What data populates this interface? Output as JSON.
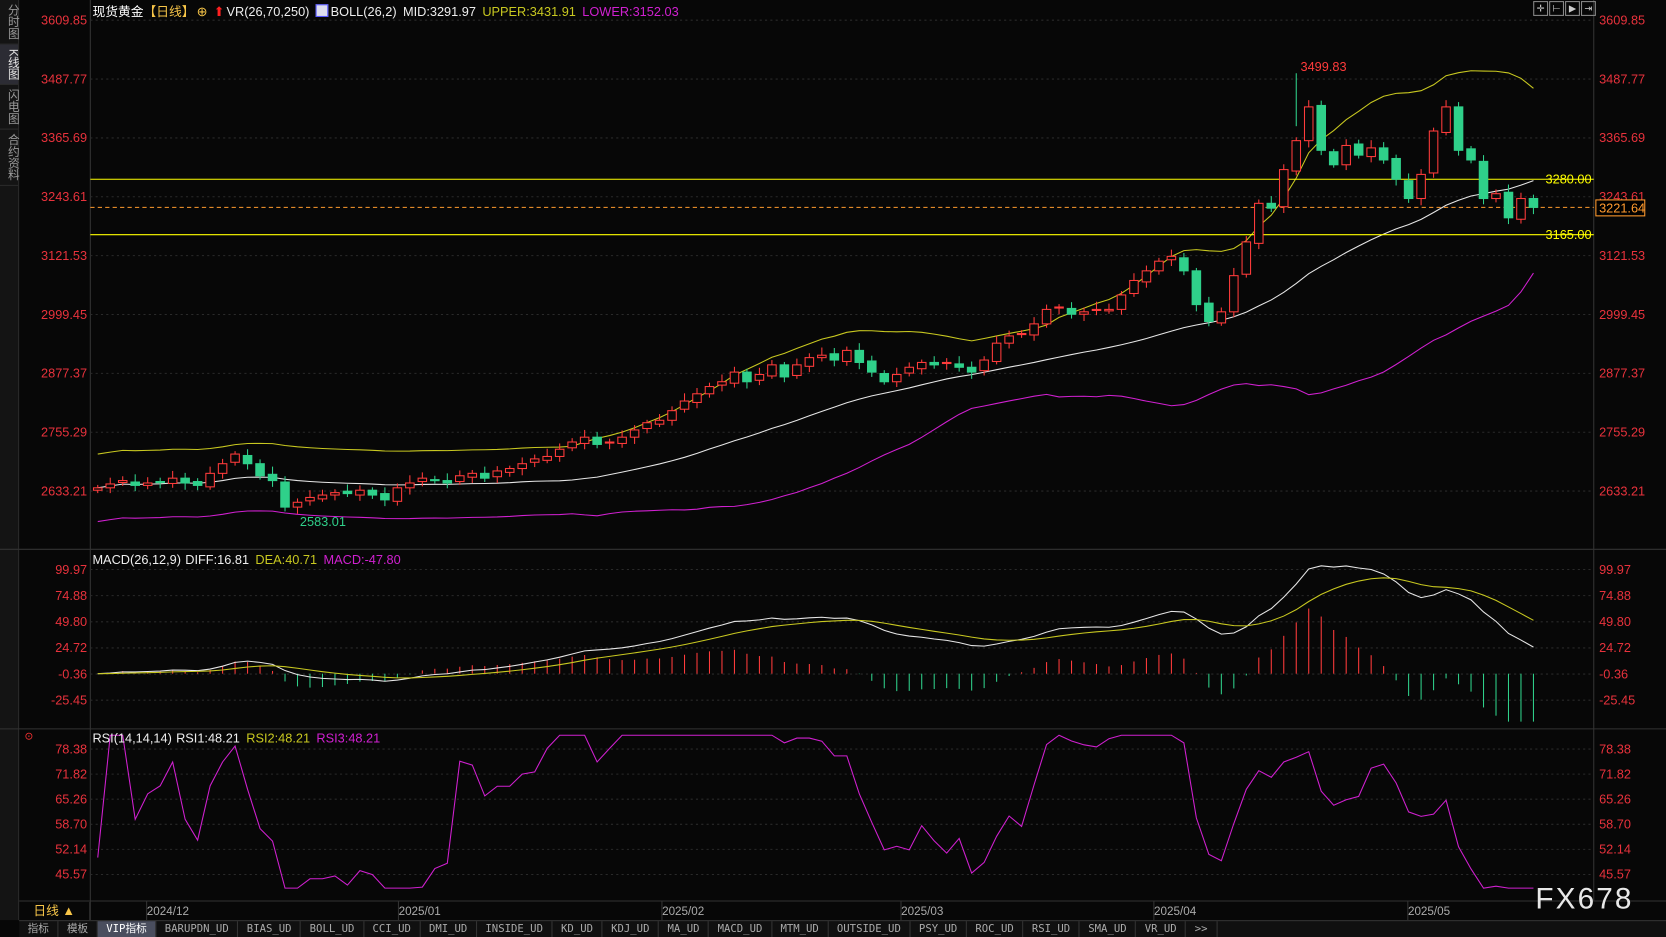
{
  "sidebar": {
    "tabs": [
      "分时图",
      "K线图",
      "闪电图",
      "合约资料"
    ],
    "active": 1
  },
  "header": {
    "instrument": "现货黄金",
    "period_tag": "【日线】",
    "vr": "VR(26,70,250)",
    "boll": "BOLL(26,2)",
    "mid": "MID:3291.97",
    "upper": "UPPER:3431.91",
    "lower": "LOWER:3152.03"
  },
  "macd_header": {
    "name": "MACD(26,12,9)",
    "diff": "DIFF:16.81",
    "dea": "DEA:40.71",
    "macd": "MACD:-47.80"
  },
  "rsi_header": {
    "name": "RSI(14,14,14)",
    "rsi1": "RSI1:48.21",
    "rsi2": "RSI2:48.21",
    "rsi3": "RSI3:48.21"
  },
  "colors": {
    "up": "#ff3b3b",
    "down": "#2fd08a",
    "upper": "#c8c820",
    "mid": "#e6e6e6",
    "lower": "#d020d0",
    "axis_label": "#e8323c",
    "level": "#ffff00",
    "current": "#ff9a2e"
  },
  "chart_data": [
    {
      "type": "candlestick",
      "title": "现货黄金",
      "y_ticks": [
        3609.85,
        3487.77,
        3365.69,
        3243.61,
        3121.53,
        2999.45,
        2877.37,
        2755.29,
        2633.21
      ],
      "x_ticks": [
        "2024/12",
        "2025/01",
        "2025/02",
        "2025/03",
        "2025/04",
        "2025/05"
      ],
      "closes": [
        2640,
        2648,
        2655,
        2645,
        2650,
        2652,
        2660,
        2650,
        2645,
        2670,
        2690,
        2710,
        2690,
        2665,
        2655,
        2600,
        2610,
        2620,
        2625,
        2630,
        2628,
        2635,
        2625,
        2615,
        2640,
        2650,
        2660,
        2655,
        2650,
        2665,
        2670,
        2660,
        2675,
        2680,
        2690,
        2700,
        2705,
        2720,
        2735,
        2745,
        2730,
        2735,
        2745,
        2760,
        2775,
        2780,
        2800,
        2820,
        2835,
        2850,
        2860,
        2880,
        2860,
        2875,
        2895,
        2870,
        2895,
        2910,
        2915,
        2905,
        2925,
        2900,
        2880,
        2860,
        2875,
        2890,
        2900,
        2895,
        2900,
        2890,
        2880,
        2905,
        2940,
        2955,
        2960,
        2980,
        3010,
        3015,
        3000,
        3005,
        3010,
        3010,
        3040,
        3070,
        3090,
        3110,
        3120,
        3090,
        3020,
        2985,
        3005,
        3080,
        3150,
        3230,
        3220,
        3300,
        3360,
        3430,
        3340,
        3310,
        3350,
        3330,
        3345,
        3320,
        3280,
        3240,
        3290,
        3380,
        3430,
        3340,
        3320,
        3240,
        3250,
        3200,
        3240,
        3221.64
      ],
      "high_label": "3499.83",
      "high_value": 3499.83,
      "low_label": "2583.01",
      "low_value": 2583.01,
      "levels": [
        {
          "value": 3280.0,
          "label": "3280.00"
        },
        {
          "value": 3165.0,
          "label": "3165.00"
        }
      ],
      "current_price": {
        "value": 3221.64,
        "label": "3221.64"
      }
    },
    {
      "type": "line",
      "name": "MACD(26,12,9)",
      "y_ticks": [
        99.97,
        74.88,
        49.8,
        24.72,
        -0.36,
        -25.45
      ]
    },
    {
      "type": "line",
      "name": "RSI(14,14,14)",
      "y_ticks": [
        78.38,
        71.82,
        65.26,
        58.7,
        52.14,
        45.57
      ]
    }
  ],
  "footer": {
    "period": "日线 ▲",
    "logo": "FX678"
  },
  "tabs": [
    "指标",
    "模板",
    "VIP指标",
    "BARUPDN_UD",
    "BIAS_UD",
    "BOLL_UD",
    "CCI_UD",
    "DMI_UD",
    "INSIDE_UD",
    "KD_UD",
    "KDJ_UD",
    "MA_UD",
    "MACD_UD",
    "MTM_UD",
    "OUTSIDE_UD",
    "PSY_UD",
    "ROC_UD",
    "RSI_UD",
    "SMA_UD",
    "VR_UD",
    ">>"
  ],
  "active_tab": 2
}
